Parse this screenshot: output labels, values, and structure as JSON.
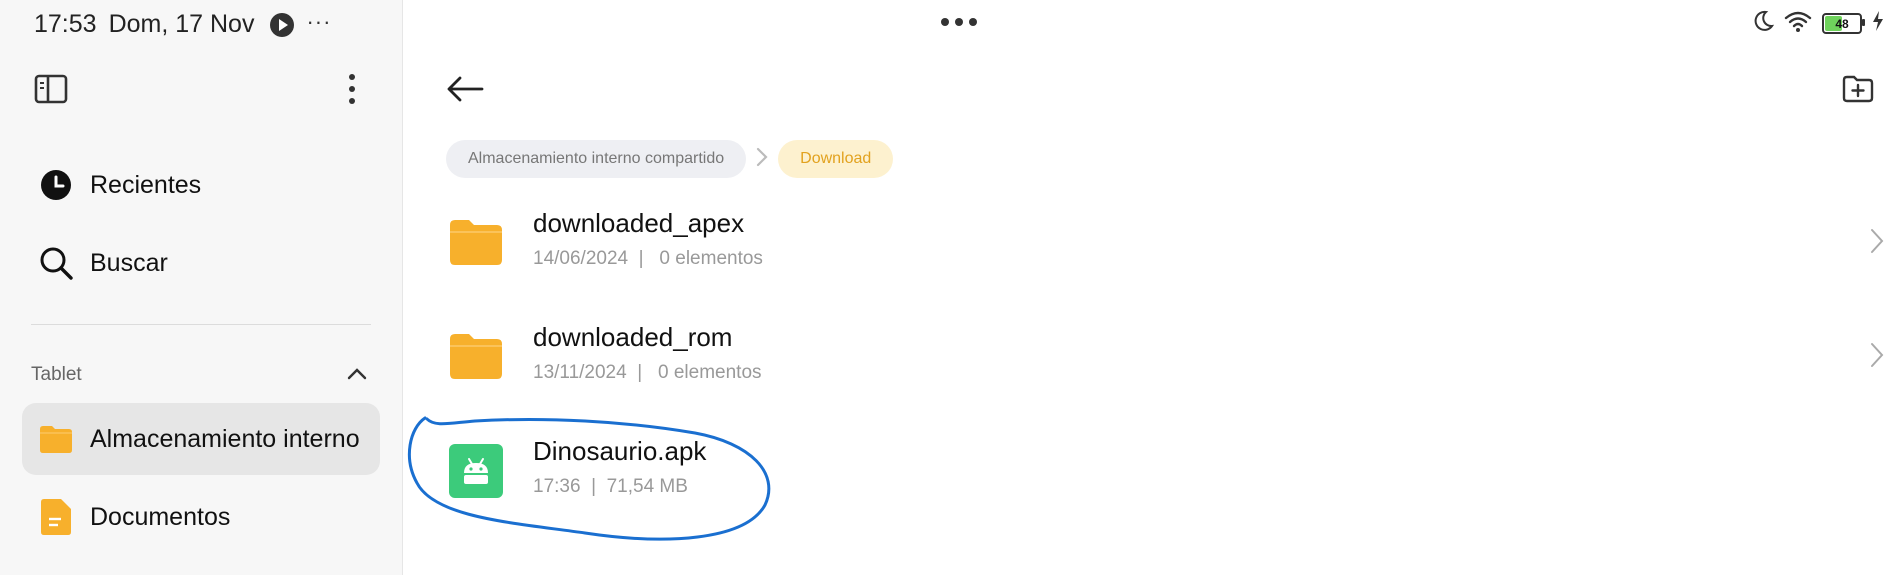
{
  "status_bar": {
    "time": "17:53",
    "date": "Dom, 17 Nov",
    "more_glyph": "···",
    "battery_level": "48"
  },
  "sidebar": {
    "nav": [
      {
        "label": "Recientes",
        "icon": "clock-icon"
      },
      {
        "label": "Buscar",
        "icon": "search-icon"
      }
    ],
    "section_title": "Tablet",
    "storage": [
      {
        "label": "Almacenamiento interno",
        "icon": "folder-icon",
        "selected": true
      },
      {
        "label": "Documentos",
        "icon": "document-icon",
        "selected": false
      }
    ]
  },
  "breadcrumb": {
    "root": "Almacenamiento interno compartido",
    "current": "Download"
  },
  "files": [
    {
      "name": "downloaded_apex",
      "meta": "14/06/2024  |   0 elementos",
      "type": "folder"
    },
    {
      "name": "downloaded_rom",
      "meta": "13/11/2024  |   0 elementos",
      "type": "folder"
    },
    {
      "name": "Dinosaurio.apk",
      "meta": "17:36  |  71,54 MB",
      "type": "apk"
    }
  ],
  "colors": {
    "folder": "#f7b02c",
    "apk": "#3ccb7b",
    "crumb_current_text": "#e2a21f",
    "annotation": "#1a6fd0"
  }
}
